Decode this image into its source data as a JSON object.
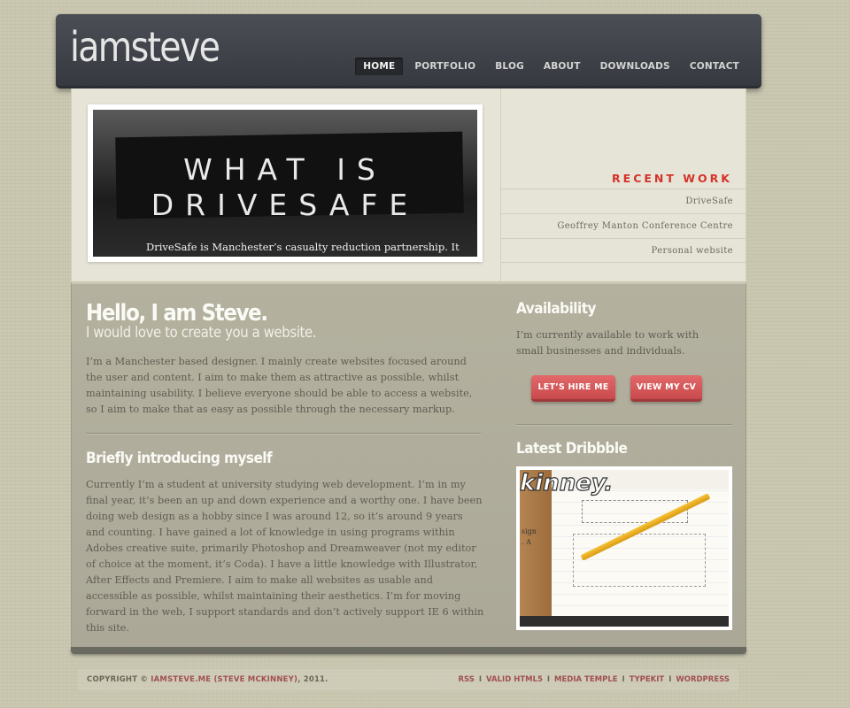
{
  "header": {
    "logo": "iamsteve",
    "nav": [
      "HOME",
      "PORTFOLIO",
      "BLOG",
      "ABOUT",
      "DOWNLOADS",
      "CONTACT"
    ],
    "active_nav": "HOME"
  },
  "featured": {
    "title_line1": "WHAT IS",
    "title_line2": "DRIVESAFE",
    "caption": "DriveSafe is Manchester’s casualty reduction partnership. It"
  },
  "recent_work": {
    "heading": "RECENT WORK",
    "items": [
      "DriveSafe",
      "Geoffrey Manton Conference Centre",
      "Personal website"
    ]
  },
  "main": {
    "hello": "Hello, I am Steve.",
    "hello_sub": "I would love to create you a website.",
    "intro": "I’m a Manchester based designer. I mainly create websites focused around the user and content. I aim to make them as attractive as possible, whilst maintaining usability. I believe everyone should be able to access a website, so I aim to make that as easy as possible through the necessary markup.",
    "brief_title": "Briefly introducing myself",
    "brief": "Currently I’m a student at university studying web development. I’m in my final year, it’s been an up and down experience and a worthy one. I have been doing web design as a hobby since I was around 12, so it’s around 9 years and counting. I have gained a lot of knowledge in using programs within Adobes creative suite, primarily Photoshop and Dreamweaver (not my editor of choice at the moment, it’s Coda). I have a little knowledge with Illustrator, After Effects and Premiere. I aim to make all websites as usable and accessible as possible, whilst maintaining their aesthetics. I’m for moving forward in the web, I support standards and don’t actively support IE 6 within this site."
  },
  "sidebar": {
    "availability_title": "Availability",
    "availability_text": "I’m currently available to work with small businesses and individuals.",
    "hire_button": "LET’S HIRE ME",
    "cv_button": "VIEW MY CV",
    "dribbble_title": "Latest Dribbble",
    "shot_script": "kinney.",
    "shot_text": "sign\n. A"
  },
  "footer": {
    "copyright_prefix": "COPYRIGHT ©",
    "copyright_link": "IAMSTEVE.ME (STEVE MCKINNEY)",
    "copyright_suffix": ", 2011.",
    "links": [
      "RSS",
      "VALID HTML5",
      "MEDIA TEMPLE",
      "TYPEKIT",
      "WORDPRESS"
    ],
    "link_separator": "I"
  },
  "colors": {
    "accent_red": "#d4322a",
    "button_red": "#e2696a",
    "header_dark": "#3d4147",
    "page_bg": "#c9c6b0"
  }
}
